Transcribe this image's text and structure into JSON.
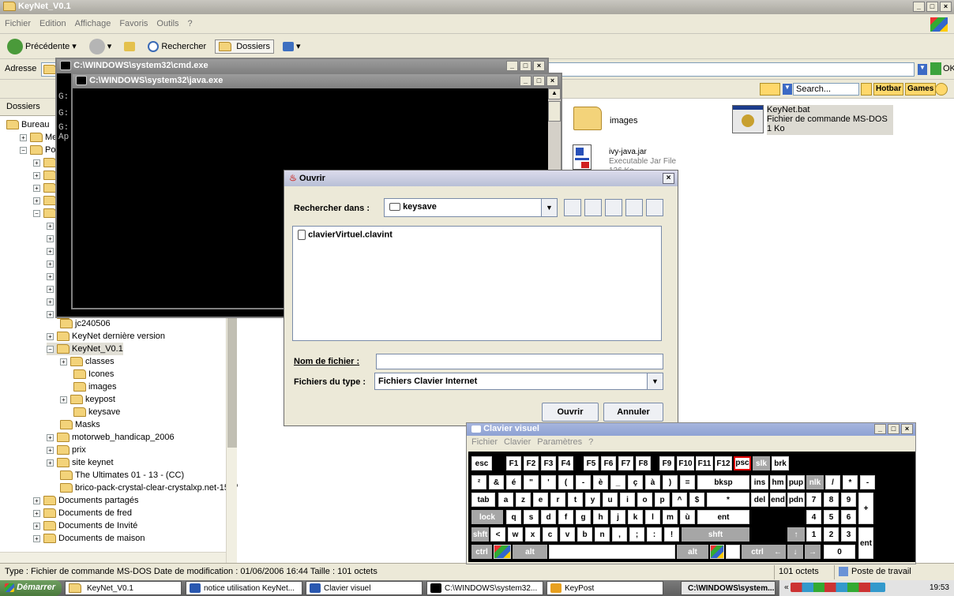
{
  "explorer": {
    "title": "KeyNet_V0.1",
    "menu": [
      "Fichier",
      "Edition",
      "Affichage",
      "Favoris",
      "Outils",
      "?"
    ],
    "toolbar": {
      "back": "Précédente",
      "search": "Rechercher",
      "folders": "Dossiers"
    },
    "address_label": "Adresse",
    "go_label": "OK",
    "links": {
      "search_placeholder": "Search...",
      "hotbar": "Hotbar",
      "games": "Games"
    },
    "folders_header": "Dossiers",
    "tree": [
      {
        "label": "Bureau",
        "indent": 0,
        "exp": ""
      },
      {
        "label": "Mes",
        "indent": 1,
        "exp": "+"
      },
      {
        "label": "Post",
        "indent": 1,
        "exp": "-"
      },
      {
        "label": "jc240506",
        "indent": 4,
        "exp": ""
      },
      {
        "label": "KeyNet dernière version",
        "indent": 3,
        "exp": "+"
      },
      {
        "label": "KeyNet_V0.1",
        "indent": 3,
        "exp": "-"
      },
      {
        "label": "classes",
        "indent": 4,
        "exp": "+"
      },
      {
        "label": "Icones",
        "indent": 5,
        "exp": ""
      },
      {
        "label": "images",
        "indent": 5,
        "exp": ""
      },
      {
        "label": "keypost",
        "indent": 4,
        "exp": "+"
      },
      {
        "label": "keysave",
        "indent": 5,
        "exp": ""
      },
      {
        "label": "Masks",
        "indent": 4,
        "exp": ""
      },
      {
        "label": "motorweb_handicap_2006",
        "indent": 3,
        "exp": "+"
      },
      {
        "label": "prix",
        "indent": 3,
        "exp": "+"
      },
      {
        "label": "site keynet",
        "indent": 3,
        "exp": "+"
      },
      {
        "label": "The Ultimates 01 - 13 - (CC)",
        "indent": 4,
        "exp": ""
      },
      {
        "label": "brico-pack-crystal-clear-crystalxp.net-15775",
        "indent": 4,
        "exp": ""
      },
      {
        "label": "Documents partagés",
        "indent": 2,
        "exp": "+"
      },
      {
        "label": "Documents de fred",
        "indent": 2,
        "exp": "+"
      },
      {
        "label": "Documents de Invité",
        "indent": 2,
        "exp": "+"
      },
      {
        "label": "Documents de maison",
        "indent": 2,
        "exp": "+"
      }
    ],
    "files": [
      {
        "name": "images",
        "type": "",
        "size": ""
      },
      {
        "name": "KeyNet.bat",
        "type": "Fichier de commande MS-DOS",
        "size": "1 Ko"
      },
      {
        "name": "ivy-java.jar",
        "type": "Executable Jar File",
        "size": "126 Ko"
      }
    ],
    "status": {
      "text": "Type : Fichier de commande MS-DOS Date de modification : 01/06/2006 16:44 Taille : 101 octets",
      "size": "101 octets",
      "zone": "Poste de travail"
    }
  },
  "cmd": {
    "title": "C:\\WINDOWS\\system32\\cmd.exe",
    "lines": [
      "G:",
      "G:",
      "G:",
      "Ap"
    ]
  },
  "java": {
    "title": "C:\\WINDOWS\\system32\\java.exe"
  },
  "dialog": {
    "title": "Ouvrir",
    "look_in_label": "Rechercher dans :",
    "look_in_value": "keysave",
    "file": "clavierVirtuel.clavint",
    "filename_label": "Nom de fichier :",
    "filename_value": "",
    "filetype_label": "Fichiers du type :",
    "filetype_value": "Fichiers Clavier Internet",
    "open_button": "Ouvrir",
    "cancel_button": "Annuler"
  },
  "keyboard": {
    "title": "Clavier visuel",
    "menu": [
      "Fichier",
      "Clavier",
      "Paramètres",
      "?"
    ],
    "rows": [
      [
        "esc",
        "F1",
        "F2",
        "F3",
        "F4",
        "F5",
        "F6",
        "F7",
        "F8",
        "F9",
        "F10",
        "F11",
        "F12",
        "psc",
        "slk",
        "brk"
      ],
      [
        "²",
        "&",
        "é",
        "\"",
        "'",
        "(",
        "-",
        "è",
        "_",
        "ç",
        "à",
        ")",
        "=",
        "bksp",
        "ins",
        "hm",
        "pup",
        "nlk",
        "/",
        "*",
        "-"
      ],
      [
        "tab",
        "a",
        "z",
        "e",
        "r",
        "t",
        "y",
        "u",
        "i",
        "o",
        "p",
        "^",
        "$",
        "*",
        "del",
        "end",
        "pdn",
        "7",
        "8",
        "9",
        "+"
      ],
      [
        "lock",
        "q",
        "s",
        "d",
        "f",
        "g",
        "h",
        "j",
        "k",
        "l",
        "m",
        "ù",
        "ent",
        "4",
        "5",
        "6"
      ],
      [
        "shft",
        "<",
        "w",
        "x",
        "c",
        "v",
        "b",
        "n",
        ",",
        ";",
        ":",
        "!",
        "shft",
        "↑",
        "1",
        "2",
        "3",
        "ent"
      ],
      [
        "ctrl",
        "alt",
        "alt",
        "ctrl",
        "←",
        "↓",
        "→",
        "0",
        "."
      ]
    ]
  },
  "taskbar": {
    "start": "Démarrer",
    "tasks": [
      "KeyNet_V0.1",
      "notice utilisation KeyNet...",
      "Clavier visuel",
      "C:\\WINDOWS\\system32...",
      "KeyPost",
      "C:\\WINDOWS\\system..."
    ],
    "clock": "19:53",
    "tray_prefix": "«"
  },
  "colors": {
    "console": "#000000",
    "selected_key_border": "#dd0000",
    "gray_key": "#a6a6a6"
  }
}
